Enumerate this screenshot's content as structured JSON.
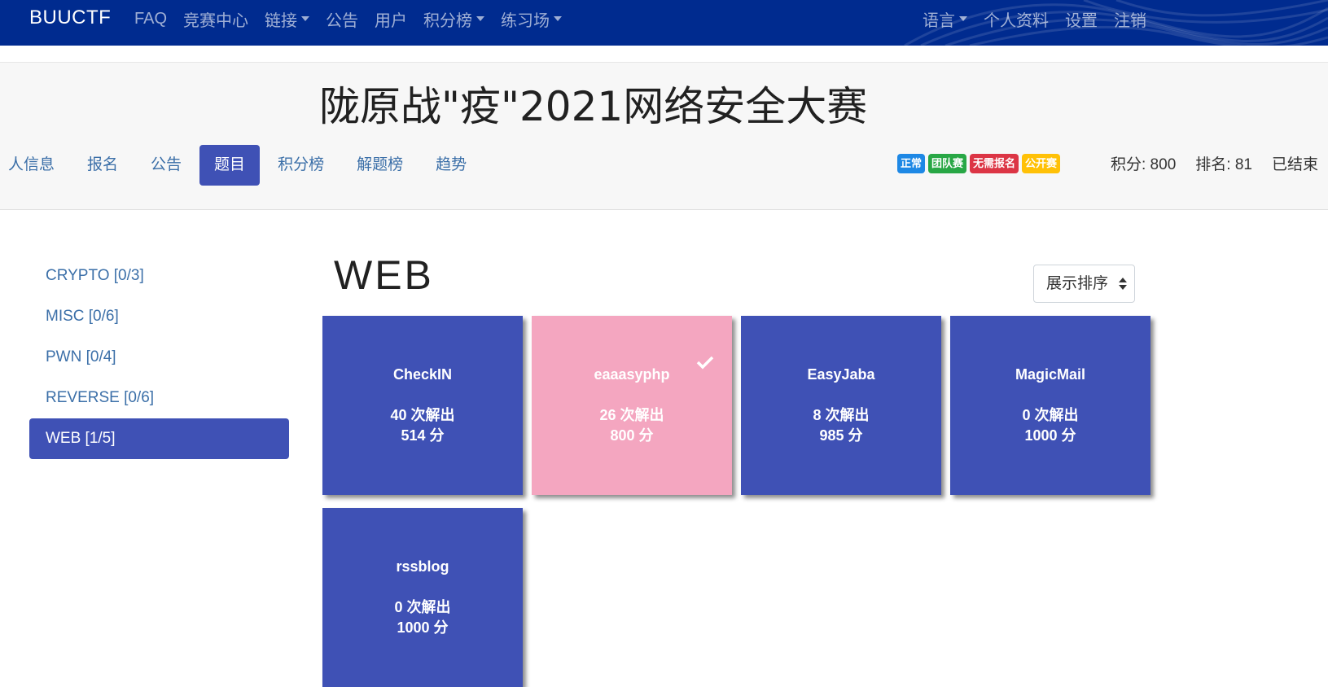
{
  "navbar": {
    "brand": "BUUCTF",
    "left_items": [
      {
        "label": "FAQ",
        "dropdown": false
      },
      {
        "label": "竞赛中心",
        "dropdown": false
      },
      {
        "label": "链接",
        "dropdown": true
      },
      {
        "label": "公告",
        "dropdown": false
      },
      {
        "label": "用户",
        "dropdown": false
      },
      {
        "label": "积分榜",
        "dropdown": true
      },
      {
        "label": "练习场",
        "dropdown": true
      }
    ],
    "right_items": [
      {
        "label": "语言",
        "dropdown": true
      },
      {
        "label": "个人资料",
        "dropdown": false
      },
      {
        "label": "设置",
        "dropdown": false
      },
      {
        "label": "注销",
        "dropdown": false
      }
    ]
  },
  "contest": {
    "title": "陇原战\"疫\"2021网络安全大赛",
    "tabs": [
      "人信息",
      "报名",
      "公告",
      "题目",
      "积分榜",
      "解题榜",
      "趋势"
    ],
    "active_tab": "题目",
    "badges": [
      {
        "label": "正常",
        "color": "#1e88e5"
      },
      {
        "label": "团队赛",
        "color": "#28a745"
      },
      {
        "label": "无需报名",
        "color": "#dc3545"
      },
      {
        "label": "公开赛",
        "color": "#ffc107"
      }
    ],
    "score": "积分: 800",
    "rank": "排名: 81",
    "status": "已结束"
  },
  "categories": [
    {
      "label": "CRYPTO [0/3]",
      "active": false
    },
    {
      "label": "MISC [0/6]",
      "active": false
    },
    {
      "label": "PWN [0/4]",
      "active": false
    },
    {
      "label": "REVERSE [0/6]",
      "active": false
    },
    {
      "label": "WEB [1/5]",
      "active": true
    }
  ],
  "main": {
    "category_title": "WEB",
    "sort_select_value": "展示排序"
  },
  "challenges": [
    {
      "name": "CheckIN",
      "solves": "40 次解出",
      "points": "514 分",
      "solved": false
    },
    {
      "name": "eaaasyphp",
      "solves": "26 次解出",
      "points": "800 分",
      "solved": true
    },
    {
      "name": "EasyJaba",
      "solves": "8 次解出",
      "points": "985 分",
      "solved": false
    },
    {
      "name": "MagicMail",
      "solves": "0 次解出",
      "points": "1000 分",
      "solved": false
    },
    {
      "name": "rssblog",
      "solves": "0 次解出",
      "points": "1000 分",
      "solved": false
    }
  ],
  "colors": {
    "navbar": "#002b8f",
    "primary": "#3f51b5",
    "solved": "#f4a6c0",
    "link": "#3b6fa8"
  }
}
